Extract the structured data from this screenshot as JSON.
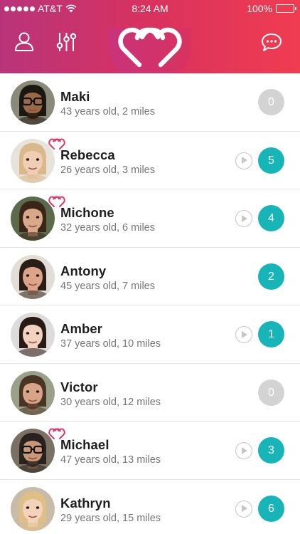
{
  "status_bar": {
    "carrier": "AT&T",
    "time": "8:24 AM",
    "battery": "100%",
    "signal_dots": 5
  },
  "header": {
    "profile_icon": "person-icon",
    "filter_icon": "sliders-icon",
    "logo": "double-heart-logo",
    "chat_icon": "chat-bubble-icon"
  },
  "colors": {
    "header_start": "#b8347a",
    "header_end": "#f03c50",
    "badge_active": "#17b5b7",
    "badge_zero": "#d3d3d3",
    "match_heart": "#d63a6a"
  },
  "people": [
    {
      "name": "Maki",
      "meta": "43 years old, 2 miles",
      "count": "0",
      "has_video": false,
      "matched": false,
      "skin": "#9a6a48",
      "hair": "#1d1712",
      "bg": "#8a8a7a",
      "glasses": true,
      "beard": true
    },
    {
      "name": "Rebecca",
      "meta": "26 years old, 3 miles",
      "count": "5",
      "has_video": true,
      "matched": true,
      "skin": "#f0cdb4",
      "hair": "#d9b98a",
      "bg": "#e7e3da",
      "glasses": false,
      "beard": false
    },
    {
      "name": "Michone",
      "meta": "32 years old, 6 miles",
      "count": "4",
      "has_video": true,
      "matched": true,
      "skin": "#d8a888",
      "hair": "#3a2518",
      "bg": "#5a6a4a",
      "glasses": false,
      "beard": false
    },
    {
      "name": "Antony",
      "meta": "45 years old, 7 miles",
      "count": "2",
      "has_video": false,
      "matched": false,
      "skin": "#dca488",
      "hair": "#2a1d16",
      "bg": "#e2ddd6",
      "glasses": false,
      "beard": false
    },
    {
      "name": "Amber",
      "meta": "37 years old, 10 miles",
      "count": "1",
      "has_video": true,
      "matched": false,
      "skin": "#f1d2c0",
      "hair": "#2a1a14",
      "bg": "#dcdcdc",
      "glasses": false,
      "beard": false
    },
    {
      "name": "Victor",
      "meta": "30 years old, 12 miles",
      "count": "0",
      "has_video": false,
      "matched": false,
      "skin": "#d8a488",
      "hair": "#4a3424",
      "bg": "#9aa08a",
      "glasses": false,
      "beard": true
    },
    {
      "name": "Michael",
      "meta": "47 years old, 13 miles",
      "count": "3",
      "has_video": true,
      "matched": true,
      "skin": "#c89878",
      "hair": "#2a221e",
      "bg": "#7a7064",
      "glasses": true,
      "beard": true
    },
    {
      "name": "Kathryn",
      "meta": "29 years old, 15 miles",
      "count": "6",
      "has_video": true,
      "matched": false,
      "skin": "#f2d2b8",
      "hair": "#e0bf86",
      "bg": "#c8bca8",
      "glasses": false,
      "beard": false
    }
  ]
}
